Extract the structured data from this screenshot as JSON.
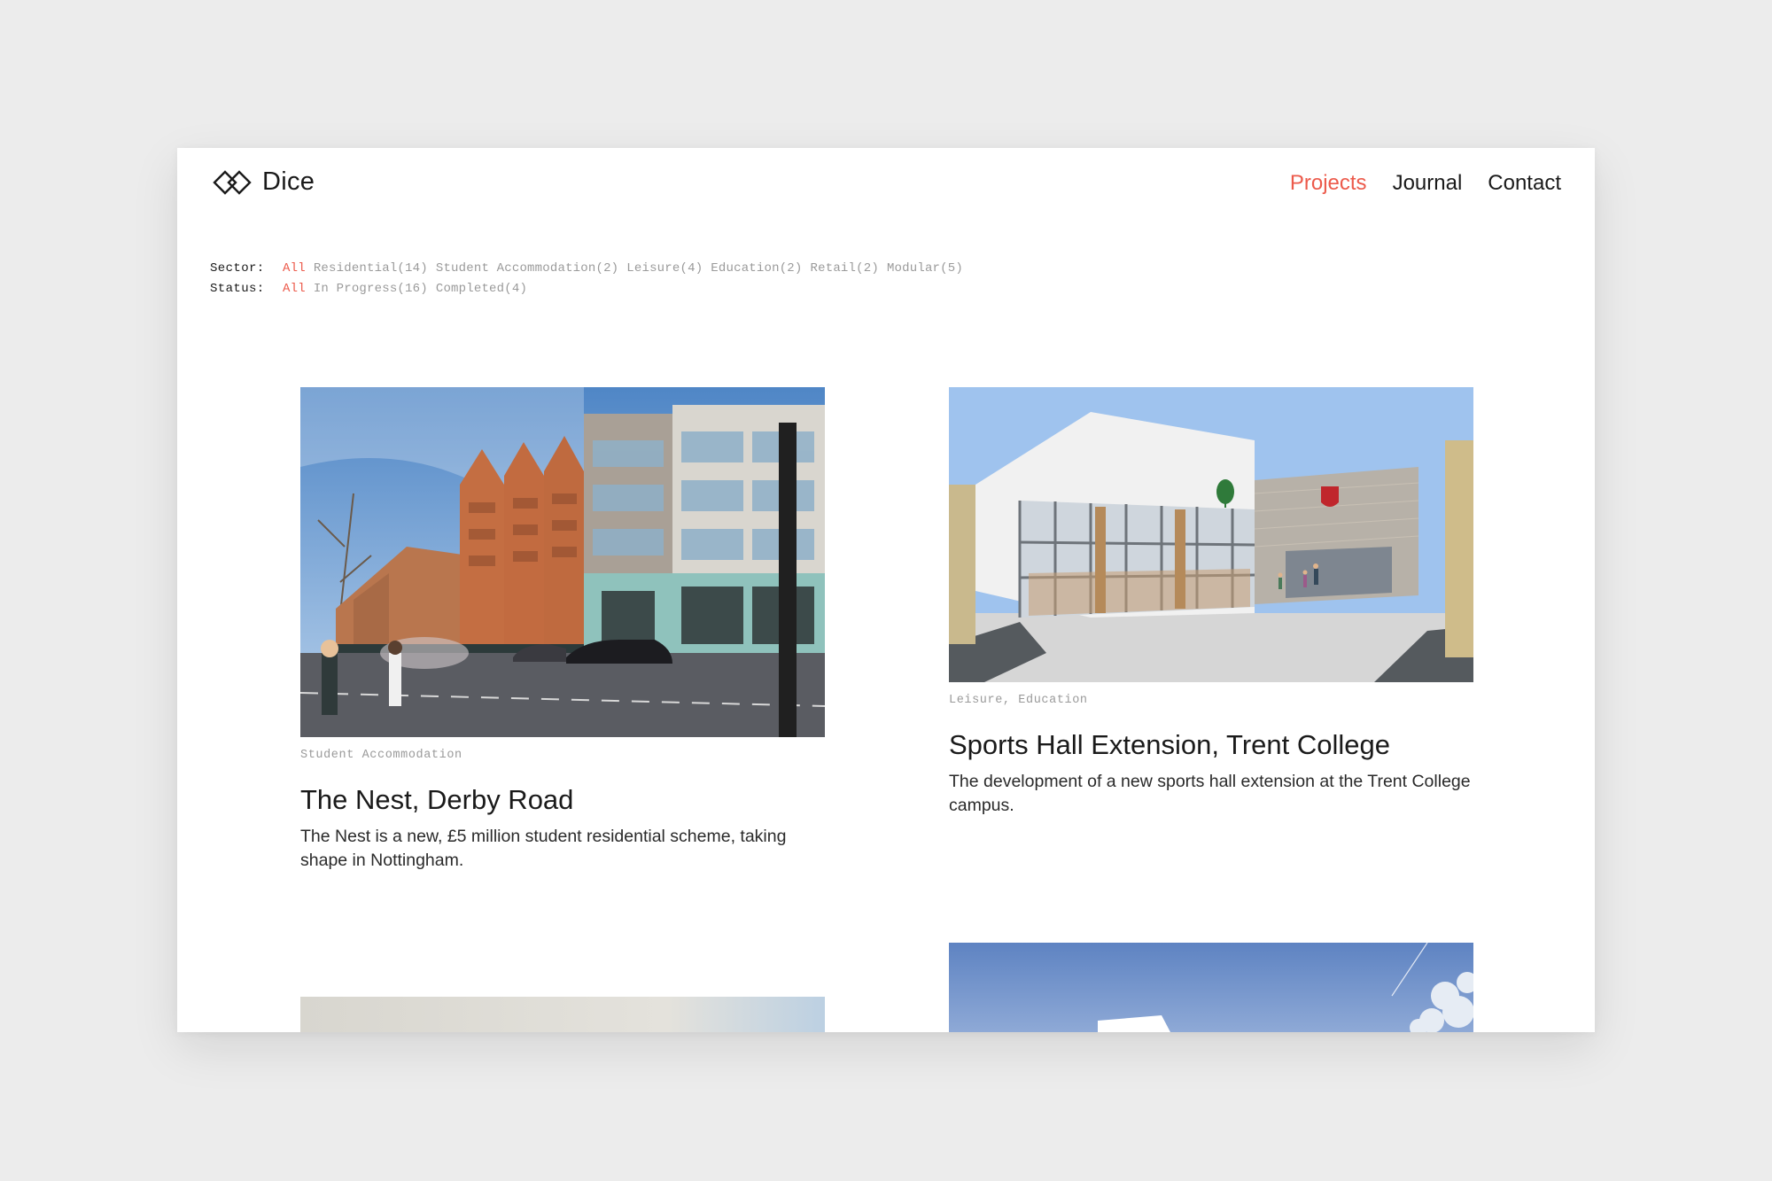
{
  "header": {
    "logo_text": "Dice",
    "nav": [
      {
        "label": "Projects",
        "active": true
      },
      {
        "label": "Journal",
        "active": false
      },
      {
        "label": "Contact",
        "active": false
      }
    ]
  },
  "filters": {
    "sector": {
      "label": "Sector:",
      "options": [
        "All",
        "Residential(14)",
        "Student Accommodation(2)",
        "Leisure(4)",
        "Education(2)",
        "Retail(2)",
        "Modular(5)"
      ]
    },
    "status": {
      "label": "Status:",
      "options": [
        "All",
        "In Progress(16)",
        "Completed(4)"
      ]
    }
  },
  "projects": [
    {
      "tag": "Student Accommodation",
      "title": "The Nest, Derby Road",
      "description": "The Nest is a new, £5 million student residential scheme, taking shape in Nottingham."
    },
    {
      "tag": "Leisure, Education",
      "title": "Sports Hall Extension, Trent College",
      "description": "The development of a new sports hall extension at the Trent College campus."
    }
  ],
  "colors": {
    "accent": "#ec5a4b",
    "background": "#ececec",
    "text": "#1a1a1a",
    "muted": "#9a9a9a"
  }
}
